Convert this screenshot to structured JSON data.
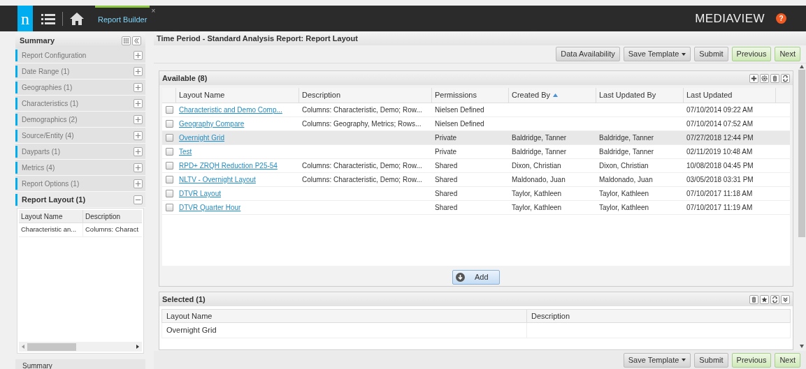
{
  "topbar": {
    "logo": "n",
    "tab": {
      "label": "Report Builder",
      "selected": true,
      "close": "×"
    },
    "brand": "MEDIAVIEW",
    "help": "?"
  },
  "sidebar": {
    "title": "Summary",
    "items": [
      {
        "label": "Report Configuration",
        "expanded": false
      },
      {
        "label": "Date Range (1)",
        "expanded": false
      },
      {
        "label": "Geographies (1)",
        "expanded": false
      },
      {
        "label": "Characteristics (1)",
        "expanded": false
      },
      {
        "label": "Demographics (2)",
        "expanded": false
      },
      {
        "label": "Source/Entity (4)",
        "expanded": false
      },
      {
        "label": "Dayparts (1)",
        "expanded": false
      },
      {
        "label": "Metrics (4)",
        "expanded": false
      },
      {
        "label": "Report Options (1)",
        "expanded": false
      },
      {
        "label": "Report Layout (1)",
        "expanded": true
      }
    ],
    "layout_table": {
      "columns": [
        "Layout Name",
        "Description"
      ],
      "rows": [
        [
          "Characteristic an...",
          "Columns: Charact"
        ]
      ]
    },
    "footer": "Summary"
  },
  "main": {
    "title": "Time Period - Standard Analysis Report: Report Layout",
    "toolbar": [
      {
        "label": "Data Availability",
        "kind": "plain"
      },
      {
        "label": "Save Template",
        "kind": "dropdown"
      },
      {
        "label": "Submit",
        "kind": "plain"
      },
      {
        "label": "Previous",
        "kind": "green"
      },
      {
        "label": "Next",
        "kind": "green"
      }
    ],
    "available": {
      "title": "Available (8)",
      "columns": [
        {
          "label": "Layout Name",
          "sorted": false
        },
        {
          "label": "Description",
          "sorted": false
        },
        {
          "label": "Permissions",
          "sorted": false
        },
        {
          "label": "Created By",
          "sorted": true
        },
        {
          "label": "Last Updated By",
          "sorted": false
        },
        {
          "label": "Last Updated",
          "sorted": false
        }
      ],
      "rows": [
        {
          "selected": false,
          "checked": false,
          "cells": [
            "Characteristic and Demo Comp...",
            "Columns: Characteristic, Demo; Row...",
            "Nielsen Defined",
            "",
            "",
            "07/10/2014 09:22 AM"
          ]
        },
        {
          "selected": false,
          "checked": false,
          "cells": [
            "Geography Compare",
            "Columns: Geography, Metrics; Rows...",
            "Nielsen Defined",
            "",
            "",
            "07/10/2014 07:52 AM"
          ]
        },
        {
          "selected": true,
          "checked": false,
          "cells": [
            "Overnight Grid",
            "",
            "Private",
            "Baldridge, Tanner",
            "Baldridge, Tanner",
            "07/27/2018 12:44 PM"
          ]
        },
        {
          "selected": false,
          "checked": false,
          "cells": [
            "Test",
            "",
            "Private",
            "Baldridge, Tanner",
            "Baldridge, Tanner",
            "02/11/2019 10:48 AM"
          ]
        },
        {
          "selected": false,
          "checked": false,
          "cells": [
            "RPD+  ZRQH Reduction  P25-54",
            "Columns: Characteristic, Demo; Row...",
            "Shared",
            "Dixon, Christian",
            "Dixon, Christian",
            "10/08/2018 04:45 PM"
          ]
        },
        {
          "selected": false,
          "checked": false,
          "cells": [
            "NLTV - Overnight Layout",
            "Columns: Characteristic, Demo; Row...",
            "Shared",
            "Maldonado, Juan",
            "Maldonado, Juan",
            "03/05/2018 03:31 PM"
          ]
        },
        {
          "selected": false,
          "checked": false,
          "cells": [
            "DTVR Layout",
            "",
            "Shared",
            "Taylor, Kathleen",
            "Taylor, Kathleen",
            "07/10/2017 11:18 AM"
          ]
        },
        {
          "selected": false,
          "checked": false,
          "cells": [
            "DTVR Quarter Hour",
            "",
            "Shared",
            "Taylor, Kathleen",
            "Taylor, Kathleen",
            "07/10/2017 11:19 AM"
          ]
        }
      ],
      "add_button": "Add"
    },
    "selected": {
      "title": "Selected (1)",
      "columns": [
        "Layout Name",
        "Description"
      ],
      "rows": [
        [
          "Overnight Grid",
          ""
        ]
      ]
    },
    "bottom_toolbar": [
      {
        "label": "Save Template",
        "kind": "dropdown"
      },
      {
        "label": "Submit",
        "kind": "plain"
      },
      {
        "label": "Previous",
        "kind": "green"
      },
      {
        "label": "Next",
        "kind": "green"
      }
    ]
  }
}
